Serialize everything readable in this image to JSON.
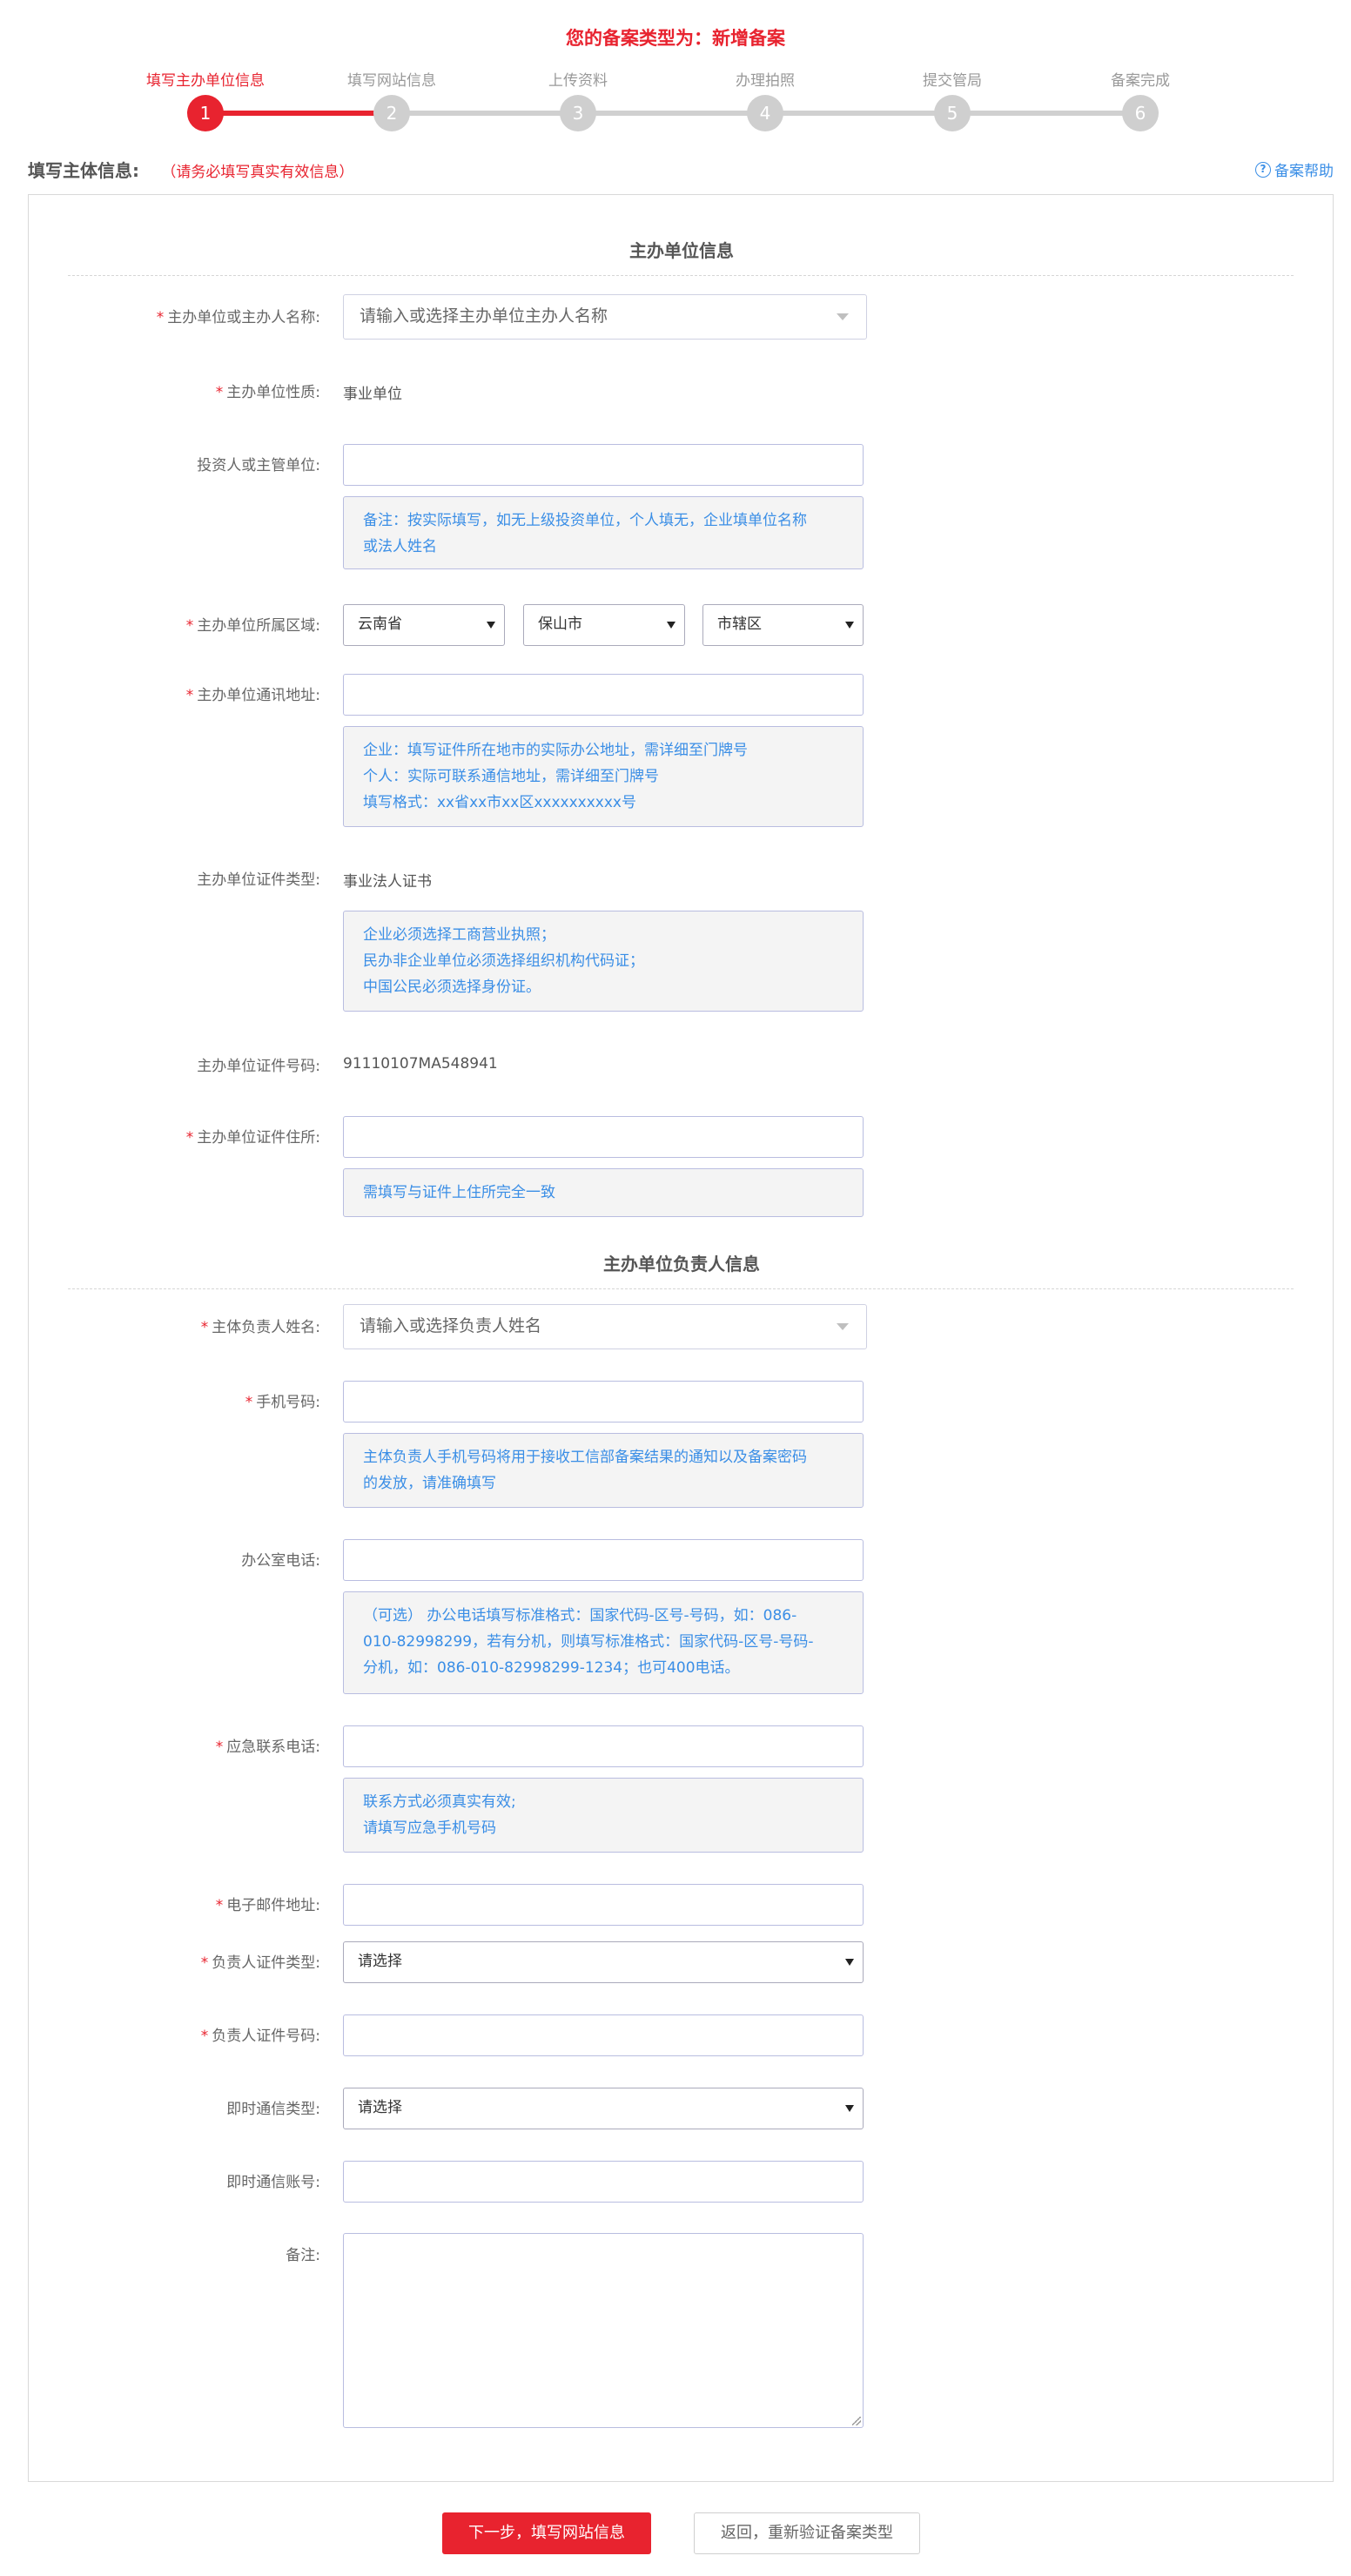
{
  "header": {
    "title": "您的备案类型为：新增备案"
  },
  "steps": [
    {
      "label": "填写主办单位信息",
      "num": "1"
    },
    {
      "label": "填写网站信息",
      "num": "2"
    },
    {
      "label": "上传资料",
      "num": "3"
    },
    {
      "label": "办理拍照",
      "num": "4"
    },
    {
      "label": "提交管局",
      "num": "5"
    },
    {
      "label": "备案完成",
      "num": "6"
    }
  ],
  "section": {
    "title": "填写主体信息:",
    "note": "（请务必填写真实有效信息）",
    "help": "备案帮助",
    "help_icon": "?"
  },
  "host": {
    "group_title": "主办单位信息",
    "name_label": "主办单位或主办人名称:",
    "name_placeholder": "请输入或选择主办单位主办人名称",
    "nature_label": "主办单位性质:",
    "nature_value": "事业单位",
    "investor_label": "投资人或主管单位:",
    "investor_tip_1": "备注：按实际填写，如无上级投资单位，个人填无，企业填单位名称",
    "investor_tip_2": "或法人姓名",
    "region_label": "主办单位所属区域:",
    "province": "云南省",
    "city": "保山市",
    "district": "市辖区",
    "address_label": "主办单位通讯地址:",
    "address_tip_1": "企业：填写证件所在地市的实际办公地址，需详细至门牌号",
    "address_tip_2": "个人：实际可联系通信地址，需详细至门牌号",
    "address_tip_3": "填写格式：xx省xx市xx区xxxxxxxxxx号",
    "cert_type_label": "主办单位证件类型:",
    "cert_type_value": "事业法人证书",
    "cert_tip_1": "企业必须选择工商营业执照；",
    "cert_tip_2": "民办非企业单位必须选择组织机构代码证；",
    "cert_tip_3": "中国公民必须选择身份证。",
    "cert_no_label": "主办单位证件号码:",
    "cert_no_value": "91110107MA548941",
    "cert_addr_label": "主办单位证件住所:",
    "cert_addr_tip": "需填写与证件上住所完全一致"
  },
  "owner": {
    "group_title": "主办单位负责人信息",
    "name_label": "主体负责人姓名:",
    "name_placeholder": "请输入或选择负责人姓名",
    "mobile_label": "手机号码:",
    "mobile_tip_1": "主体负责人手机号码将用于接收工信部备案结果的通知以及备案密码",
    "mobile_tip_2": "的发放，请准确填写",
    "office_label": "办公室电话:",
    "office_tip_1": "（可选） 办公电话填写标准格式：国家代码-区号-号码，如：086-",
    "office_tip_2": "010-82998299，若有分机，则填写标准格式：国家代码-区号-号码-",
    "office_tip_3": "分机，如：086-010-82998299-1234；也可400电话。",
    "emergency_label": "应急联系电话:",
    "emergency_tip_1": "联系方式必须真实有效;",
    "emergency_tip_2": "请填写应急手机号码",
    "email_label": "电子邮件地址:",
    "id_type_label": "负责人证件类型:",
    "id_type_value": "请选择",
    "id_no_label": "负责人证件号码:",
    "im_type_label": "即时通信类型:",
    "im_type_value": "请选择",
    "im_account_label": "即时通信账号:",
    "remark_label": "备注:"
  },
  "buttons": {
    "next": "下一步，填写网站信息",
    "back": "返回，重新验证备案类型"
  },
  "colors": {
    "accent": "#e8232f",
    "link": "#3a8ee6",
    "tip_bg": "#f4f4f4"
  }
}
